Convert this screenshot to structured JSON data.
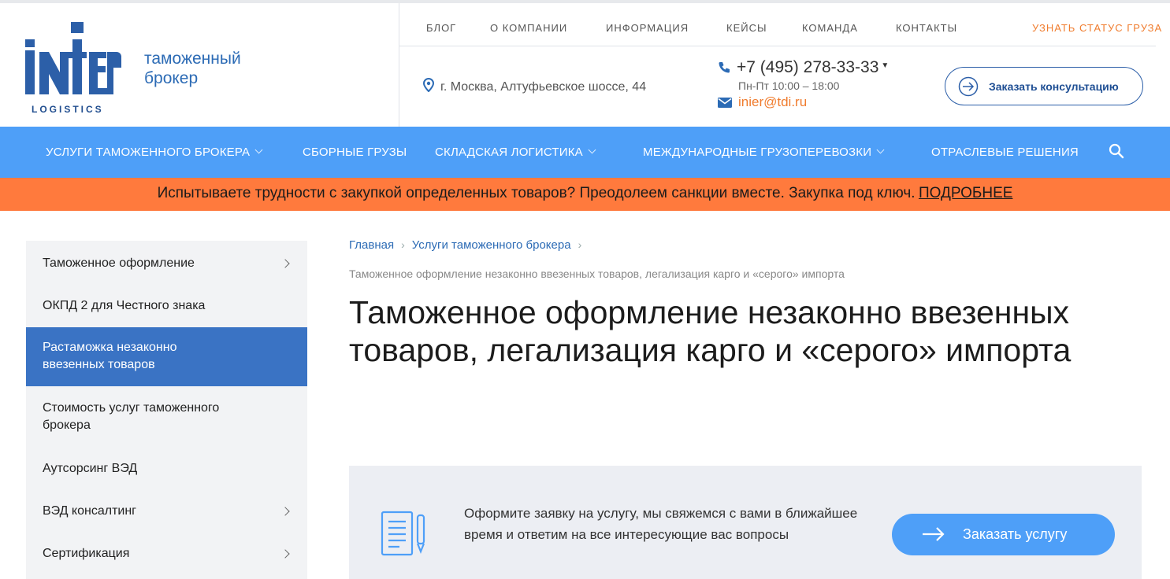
{
  "logo": {
    "word": "inter",
    "sub": "LOGISTICS",
    "tagline_line1": "таможенный",
    "tagline_line2": "брокер"
  },
  "top_nav": [
    "БЛОГ",
    "О КОМПАНИИ",
    "ИНФОРМАЦИЯ",
    "КЕЙСЫ",
    "КОМАНДА",
    "КОНТАКТЫ"
  ],
  "cargo_status": "УЗНАТЬ СТАТУС ГРУЗА",
  "contacts": {
    "address": "г. Москва, Алтуфьевское шоссе, 44",
    "phone": "+7 (495) 278-33-33",
    "hours": "Пн-Пт 10:00 – 18:00",
    "email": "inier@tdi.ru"
  },
  "consult_button": "Заказать консультацию",
  "main_menu": [
    {
      "label": "УСЛУГИ ТАМОЖЕННОГО БРОКЕРА",
      "dropdown": true
    },
    {
      "label": "СБОРНЫЕ ГРУЗЫ",
      "dropdown": false
    },
    {
      "label": "СКЛАДСКАЯ ЛОГИСТИКА",
      "dropdown": true
    },
    {
      "label": "МЕЖДУНАРОДНЫЕ ГРУЗОПЕРЕВОЗКИ",
      "dropdown": true
    },
    {
      "label": "ОТРАСЛЕВЫЕ РЕШЕНИЯ",
      "dropdown": false
    }
  ],
  "banner": {
    "text": "Испытываете трудности с закупкой определенных товаров? Преодолеем санкции вместе. Закупка под ключ.",
    "link": "ПОДРОБНЕЕ"
  },
  "sidebar": [
    {
      "line1": "Таможенное оформление",
      "line2": "",
      "arrow": true,
      "active": false
    },
    {
      "line1": "ОКПД 2 для Честного знака",
      "line2": "",
      "arrow": false,
      "active": false
    },
    {
      "line1": "Растаможка незаконно",
      "line2": "ввезенных товаров",
      "arrow": false,
      "active": true
    },
    {
      "line1": "Стоимость услуг таможенного",
      "line2": "брокера",
      "arrow": false,
      "active": false
    },
    {
      "line1": "Аутсорсинг ВЭД",
      "line2": "",
      "arrow": false,
      "active": false
    },
    {
      "line1": "ВЭД консалтинг",
      "line2": "",
      "arrow": true,
      "active": false
    },
    {
      "line1": "Сертификация",
      "line2": "",
      "arrow": true,
      "active": false
    }
  ],
  "breadcrumbs": [
    "Главная",
    "Услуги таможенного брокера"
  ],
  "page_subtitle": "Таможенное оформление незаконно ввезенных товаров, легализация карго и «серого» импорта",
  "page_title": "Таможенное оформление незаконно ввезенных товаров, легализация карго и «серого» импорта",
  "order": {
    "text": "Оформите заявку на услугу, мы свяжемся с вами в ближайшее время и ответим на все интересующие вас вопросы",
    "button": "Заказать услугу"
  },
  "colors": {
    "menu_blue": "#4e9ff8",
    "banner_orange": "#ff7a3d",
    "active_blue": "#3a73c4",
    "brand_dark": "#214e8f",
    "accent_orange": "#f07c2e"
  }
}
